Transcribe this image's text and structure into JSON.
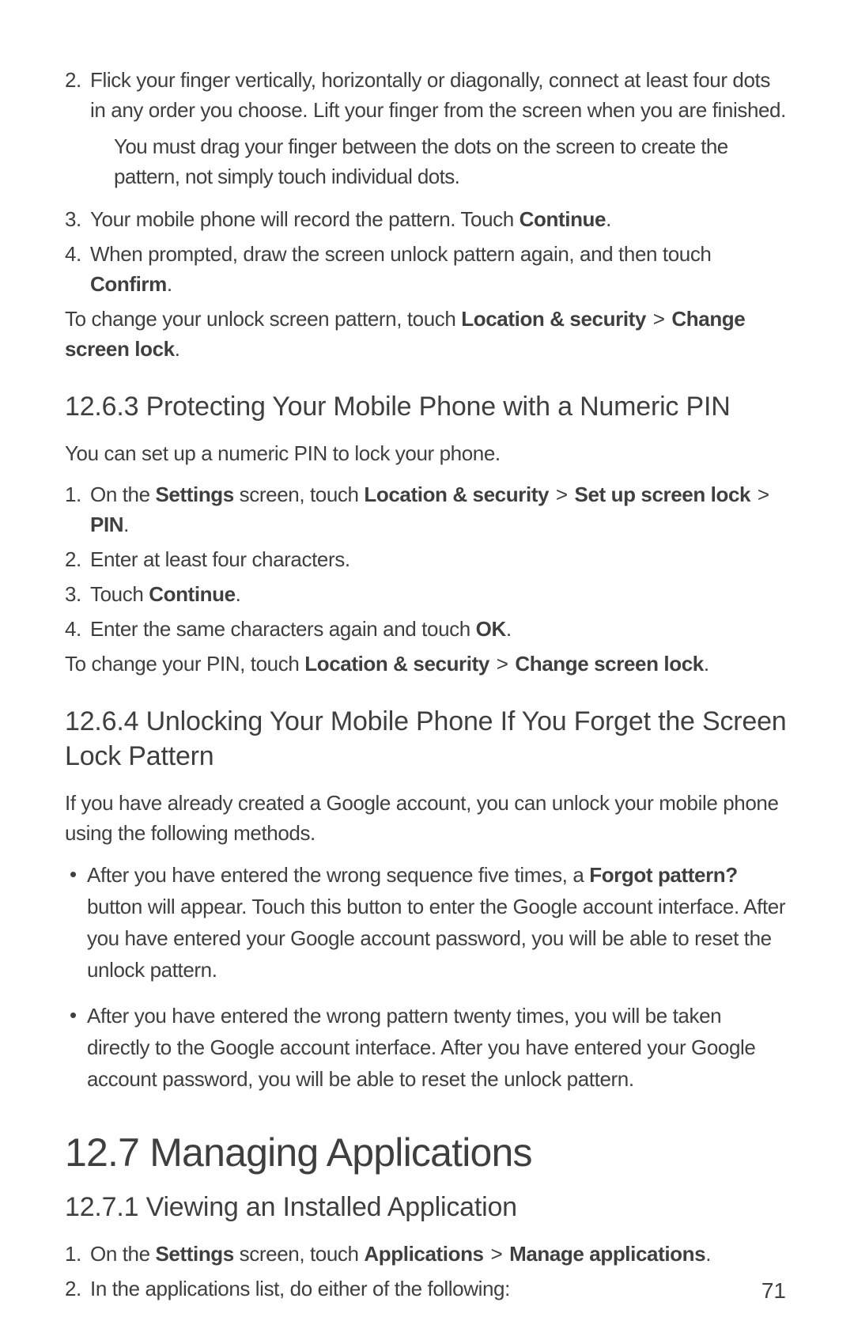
{
  "steps_12_6_2_cont": {
    "s2_num": "2.",
    "s2_a": "Flick your finger vertically, horizontally or diagonally, connect at least four dots in any order you choose. Lift your finger from the screen when you are finished.",
    "s2_note": "You must drag your finger between the dots on the screen to create the pattern, not simply touch individual dots.",
    "s3_num": "3.",
    "s3_a": "Your mobile phone will record the pattern. Touch ",
    "s3_bold": "Continue",
    "s3_b": ".",
    "s4_num": "4.",
    "s4_a": "When prompted, draw the screen unlock pattern again, and then touch ",
    "s4_bold": "Confirm",
    "s4_b": "."
  },
  "p_change_pattern": {
    "a": "To change your unlock screen pattern, touch ",
    "b1": "Location & security",
    "gt": " > ",
    "b2": "Change screen lock",
    "c": "."
  },
  "h_12_6_3": "12.6.3  Protecting Your Mobile Phone with a Numeric PIN",
  "p_12_6_3_intro": "You can set up a numeric PIN to lock your phone.",
  "steps_12_6_3": {
    "s1_num": "1.",
    "s1_a": "On the ",
    "s1_b1": "Settings",
    "s1_b": " screen, touch ",
    "s1_b2": "Location & security",
    "s1_gt1": " > ",
    "s1_b3": "Set up screen lock",
    "s1_gt2": " > ",
    "s1_b4": "PIN",
    "s1_c": ".",
    "s2_num": "2.",
    "s2_a": "Enter at least four characters.",
    "s3_num": "3.",
    "s3_a": "Touch ",
    "s3_bold": "Continue",
    "s3_b": ".",
    "s4_num": "4.",
    "s4_a": "Enter the same characters again and touch ",
    "s4_bold": "OK",
    "s4_b": "."
  },
  "p_change_pin": {
    "a": "To change your PIN, touch ",
    "b1": "Location & security",
    "gt": " > ",
    "b2": "Change screen lock",
    "c": "."
  },
  "h_12_6_4": "12.6.4  Unlocking Your Mobile Phone If You Forget the Screen Lock Pattern",
  "p_12_6_4_intro": "If you have already created a Google account, you can unlock your mobile phone using the following methods.",
  "bullets_12_6_4": {
    "b1_a": "After you have entered the wrong sequence five times, a ",
    "b1_bold": "Forgot pattern?",
    "b1_b": " button will appear. Touch this button to enter the Google account interface. After you have entered your Google account password, you will be able to reset the unlock pattern.",
    "b2": "After you have entered the wrong pattern twenty times, you will be taken directly to the Google account interface. After you have entered your Google account password, you will be able to reset the unlock pattern."
  },
  "h_12_7": "12.7  Managing Applications",
  "h_12_7_1": "12.7.1  Viewing an Installed Application",
  "steps_12_7_1": {
    "s1_num": "1.",
    "s1_a": "On the ",
    "s1_b1": "Settings",
    "s1_b": " screen, touch ",
    "s1_b2": "Applications",
    "s1_gt": " > ",
    "s1_b3": "Manage applications",
    "s1_c": ".",
    "s2_num": "2.",
    "s2_a": "In the applications list, do either of the following:"
  },
  "page_number": "71",
  "bullet_char": "•"
}
